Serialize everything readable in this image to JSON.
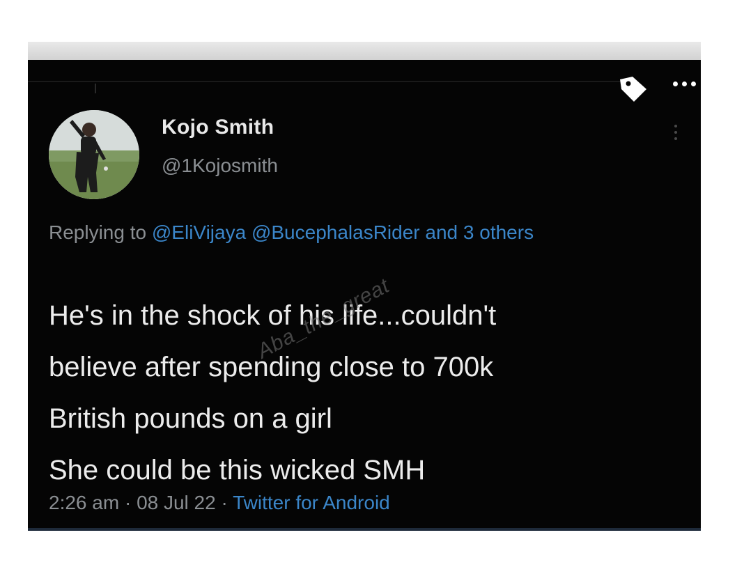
{
  "tweet": {
    "display_name": "Kojo Smith",
    "handle": "@1Kojosmith",
    "reply": {
      "prefix": "Replying to",
      "mentions": [
        "@EliVijaya",
        "@BucephalasRider"
      ],
      "others": "and 3 others"
    },
    "text_lines": [
      "He's in the shock of his life...couldn't",
      "believe after spending close to 700k",
      "British pounds on a girl",
      "She could be this wicked SMH"
    ],
    "time": "2:26 am",
    "separator": "·",
    "date": "08 Jul 22",
    "source": "Twitter for Android"
  },
  "watermark": "Aba_the_great",
  "icons": {
    "tag": "tag-icon",
    "more": "more-horizontal-icon",
    "menu": "more-vertical-icon",
    "avatar": "avatar"
  },
  "colors": {
    "background": "#050505",
    "text": "#ececec",
    "muted": "#8b8f93",
    "link": "#3b86c9"
  }
}
